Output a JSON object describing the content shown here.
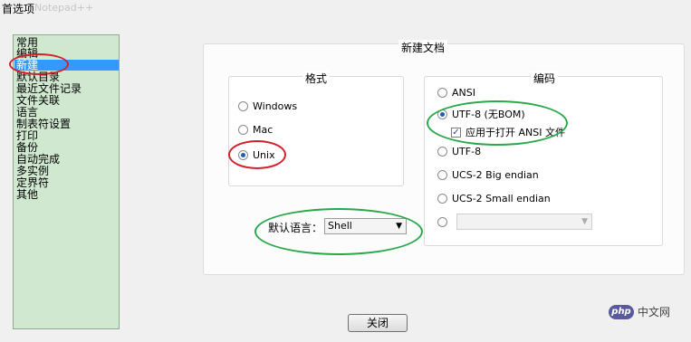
{
  "window": {
    "title": "首选项",
    "ghost_title": "Notepad++"
  },
  "sidebar": {
    "items": [
      {
        "label": "常用"
      },
      {
        "label": "编辑"
      },
      {
        "label": "新建"
      },
      {
        "label": "默认目录"
      },
      {
        "label": "最近文件记录"
      },
      {
        "label": "文件关联"
      },
      {
        "label": "语言"
      },
      {
        "label": "制表符设置"
      },
      {
        "label": "打印"
      },
      {
        "label": "备份"
      },
      {
        "label": "自动完成"
      },
      {
        "label": "多实例"
      },
      {
        "label": "定界符"
      },
      {
        "label": "其他"
      }
    ],
    "selected": "新建"
  },
  "new_document": {
    "title": "新建文档",
    "format": {
      "title": "格式",
      "options": [
        "Windows",
        "Mac",
        "Unix"
      ],
      "selected": "Unix"
    },
    "encoding": {
      "title": "编码",
      "options": [
        "ANSI",
        "UTF-8 (无BOM)",
        "UTF-8",
        "UCS-2 Big endian",
        "UCS-2 Small endian"
      ],
      "selected": "UTF-8 (无BOM)",
      "apply_ansi_label": "应用于打开 ANSI 文件",
      "apply_ansi_checked": true,
      "custom_select_value": ""
    },
    "default_language": {
      "label": "默认语言：",
      "value": "Shell"
    }
  },
  "buttons": {
    "close": "关闭"
  },
  "watermark": {
    "logo": "php",
    "text": "中文网"
  },
  "colors": {
    "sidebar_bg": "#cfe8cf",
    "selection": "#3399ff",
    "annotation_red": "#d3202b",
    "annotation_green": "#2aa84a"
  }
}
